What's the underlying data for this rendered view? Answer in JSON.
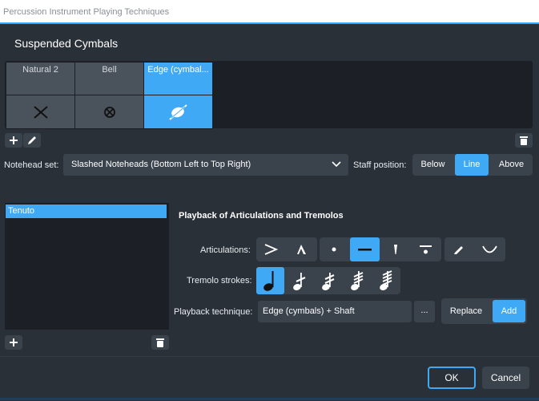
{
  "window": {
    "title": "Percussion Instrument Playing Techniques"
  },
  "dialog": {
    "heading": "Suspended Cymbals",
    "techniques": [
      {
        "label": "Natural 2",
        "symbol": "x-notehead-icon",
        "selected": false
      },
      {
        "label": "Bell",
        "symbol": "circled-x-notehead-icon",
        "selected": false
      },
      {
        "label": "Edge (cymbal...",
        "symbol": "slashed-notehead-icon",
        "selected": true
      }
    ],
    "notehead": {
      "label": "Notehead set:",
      "value": "Slashed Noteheads (Bottom Left to Top Right)"
    },
    "staff_position": {
      "label": "Staff position:",
      "options": [
        "Below",
        "Line",
        "Above"
      ],
      "selected": "Line"
    },
    "list": {
      "items": [
        "Tenuto"
      ],
      "selected": "Tenuto"
    },
    "playback": {
      "heading": "Playback of Articulations and Tremolos",
      "articulations_label": "Articulations:",
      "articulations_selected": "tenuto",
      "tremolo_label": "Tremolo strokes:",
      "tremolo_selected": 0,
      "technique_label": "Playback technique:",
      "technique_value": "Edge (cymbals) + Shaft",
      "browse_label": "...",
      "mode_options": [
        "Replace",
        "Add"
      ],
      "mode_selected": "Add"
    },
    "buttons": {
      "ok": "OK",
      "cancel": "Cancel"
    }
  },
  "colors": {
    "accent": "#3fa9f5",
    "panel": "#2a3038",
    "button": "#3a424c"
  }
}
